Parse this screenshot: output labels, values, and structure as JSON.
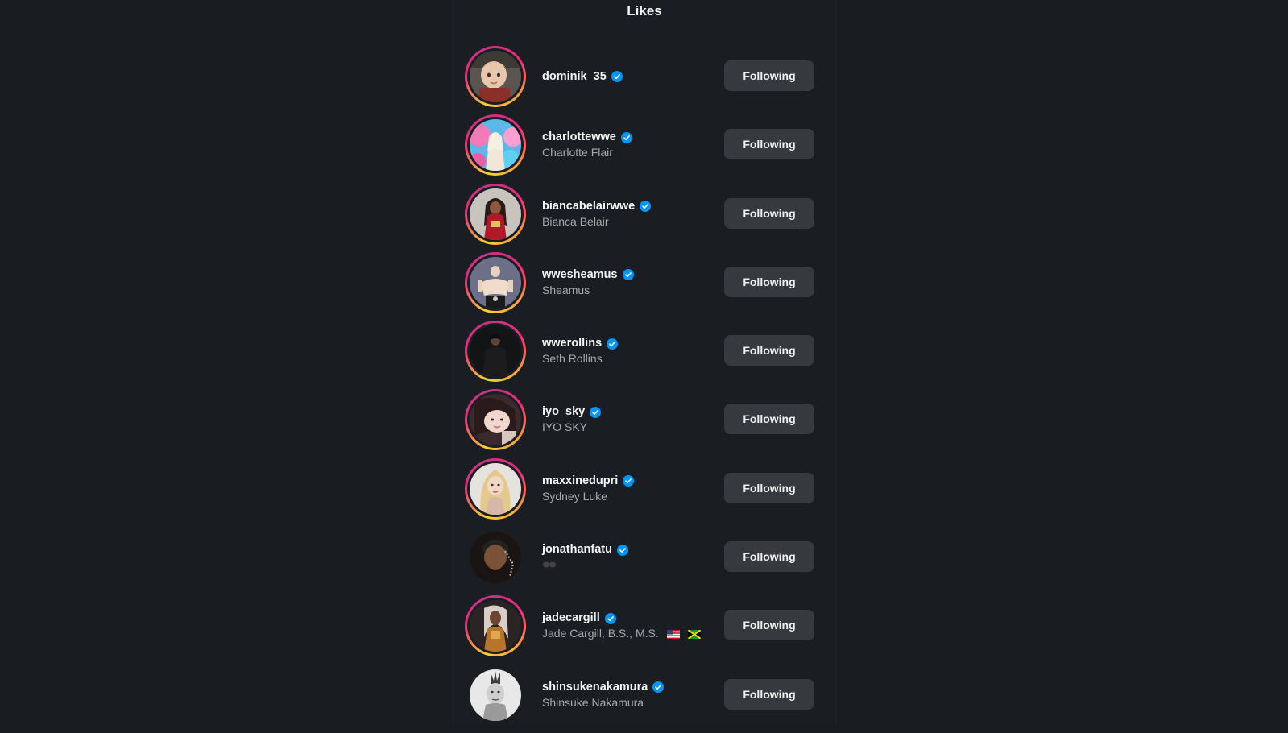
{
  "header": {
    "title": "Likes"
  },
  "colors": {
    "background": "#191d22",
    "button_bg": "#363a3f",
    "verified_blue": "#0095f6",
    "subtext": "#a8a8a8"
  },
  "users": [
    {
      "username": "dominik_35",
      "fullname": "",
      "button_label": "Following",
      "verified": true,
      "story_ring": true,
      "avatar_icon": "toddler-photo"
    },
    {
      "username": "charlottewwe",
      "fullname": "Charlotte Flair",
      "button_label": "Following",
      "verified": true,
      "story_ring": true,
      "avatar_icon": "woman-colorful-backdrop-photo"
    },
    {
      "username": "biancabelairwwe",
      "fullname": "Bianca Belair",
      "button_label": "Following",
      "verified": true,
      "story_ring": true,
      "avatar_icon": "woman-red-outfit-photo"
    },
    {
      "username": "wwesheamus",
      "fullname": "Sheamus",
      "button_label": "Following",
      "verified": true,
      "story_ring": true,
      "avatar_icon": "wrestler-photo"
    },
    {
      "username": "wwerollins",
      "fullname": "Seth Rollins",
      "button_label": "Following",
      "verified": true,
      "story_ring": true,
      "avatar_icon": "man-dark-coat-photo"
    },
    {
      "username": "iyo_sky",
      "fullname": "IYO SKY",
      "button_label": "Following",
      "verified": true,
      "story_ring": true,
      "avatar_icon": "woman-selfie-photo"
    },
    {
      "username": "maxxinedupri",
      "fullname": "Sydney Luke",
      "button_label": "Following",
      "verified": true,
      "story_ring": true,
      "avatar_icon": "blonde-woman-photo"
    },
    {
      "username": "jonathanfatu",
      "fullname": "",
      "button_label": "Following",
      "verified": true,
      "story_ring": false,
      "avatar_icon": "man-beard-photo"
    },
    {
      "username": "jadecargill",
      "fullname": "Jade Cargill, B.S., M.S.",
      "button_label": "Following",
      "verified": true,
      "story_ring": true,
      "avatar_icon": "woman-golden-outfit-photo",
      "flags": [
        "us-flag-icon",
        "jamaica-flag-icon"
      ]
    },
    {
      "username": "shinsukenakamura",
      "fullname": "Shinsuke Nakamura",
      "button_label": "Following",
      "verified": true,
      "story_ring": false,
      "avatar_icon": "man-mohawk-photo"
    }
  ]
}
